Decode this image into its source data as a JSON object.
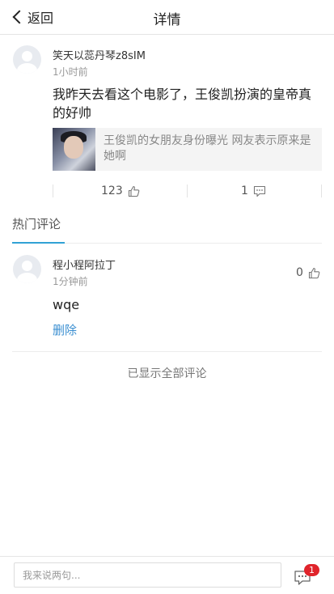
{
  "header": {
    "back_label": "返回",
    "title": "详情"
  },
  "post": {
    "author": "笑天以蕊丹琴z8sIM",
    "time": "1小时前",
    "text": "我昨天去看这个电影了，王俊凯扮演的皇帝真的好帅",
    "link": {
      "title": "王俊凯的女朋友身份曝光 网友表示原来是她啊"
    },
    "like_count": "123",
    "comment_count": "1"
  },
  "comments_section": {
    "hot_tab_label": "热门评论",
    "comments": [
      {
        "author": "程小程阿拉丁",
        "time": "1分钟前",
        "like_count": "0",
        "text": "wqe",
        "delete_label": "删除"
      }
    ],
    "all_shown_text": "已显示全部评论"
  },
  "bottom_bar": {
    "input_placeholder": "我来说两句...",
    "badge_count": "1"
  },
  "colors": {
    "accent_blue": "#31a2d5",
    "link_blue": "#3b8fd1",
    "badge_red": "#e0242b"
  }
}
